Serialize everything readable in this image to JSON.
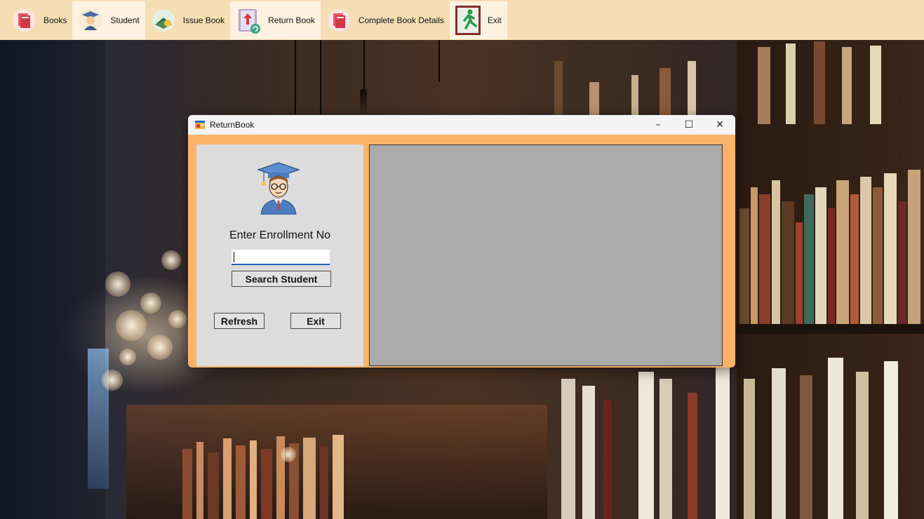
{
  "toolbar": {
    "items": [
      {
        "label": "Books",
        "icon": "books-icon"
      },
      {
        "label": "Student",
        "icon": "student-icon"
      },
      {
        "label": "Issue Book",
        "icon": "issue-book-icon"
      },
      {
        "label": "Return Book",
        "icon": "return-book-icon"
      },
      {
        "label": "Complete Book Details",
        "icon": "book-details-icon"
      },
      {
        "label": "Exit",
        "icon": "exit-icon"
      }
    ],
    "active": "Return Book"
  },
  "dialog": {
    "title": "ReturnBook",
    "controls": {
      "minimize": "–",
      "maximize": "☐",
      "close": "✕"
    },
    "prompt": "Enter Enrollment No",
    "enrollment_value": "",
    "search_label": "Search Student",
    "refresh_label": "Refresh",
    "exit_label": "Exit"
  },
  "colors": {
    "toolbar_bg": "#f5deb3",
    "dialog_frame": "#fbb36a",
    "left_panel": "#dcdcdc",
    "grid_panel": "#ababab"
  }
}
